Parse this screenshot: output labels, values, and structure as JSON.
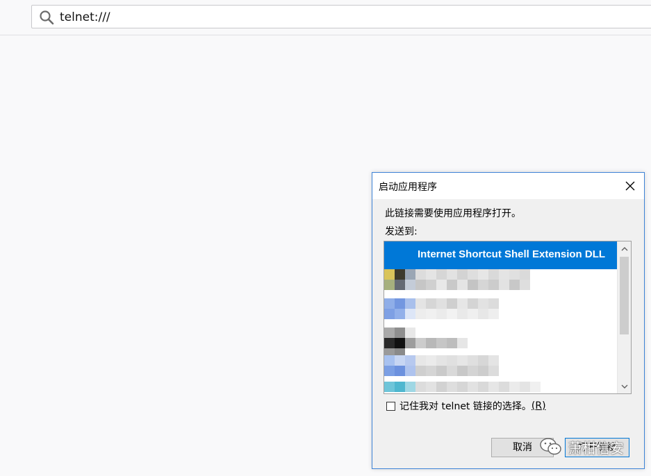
{
  "address_bar": {
    "url": "telnet:///"
  },
  "dialog": {
    "title": "启动应用程序",
    "message": "此链接需要使用应用程序打开。",
    "send_to_label": "发送到:",
    "list": {
      "selected_item": "Internet Shortcut Shell Extension DLL"
    },
    "remember_label": "记住我对 telnet 链接的选择。",
    "remember_accel": "(R)",
    "remember_checked": false,
    "cancel_label": "取消",
    "open_label": "打开链接"
  },
  "watermark": {
    "text": "萧柑信安"
  },
  "colors": {
    "selection": "#0078d7",
    "dialog_border": "#3c82d6",
    "page_bg": "#f9f9fa"
  }
}
